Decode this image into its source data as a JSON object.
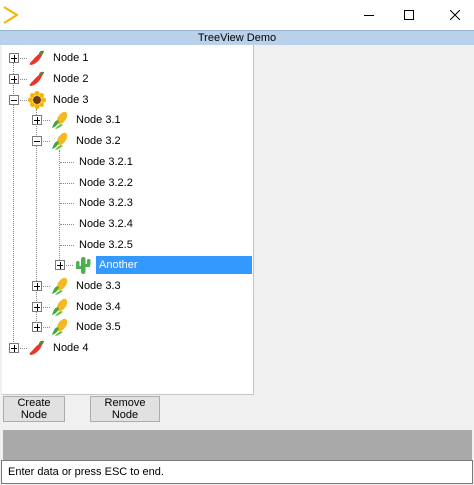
{
  "window": {
    "app_icon": "triangle-play-icon",
    "controls": [
      "minimize-icon",
      "maximize-icon",
      "close-icon"
    ]
  },
  "app": {
    "title": "TreeView Demo"
  },
  "tree": {
    "nodes": [
      {
        "label": "Node 1",
        "icon": "chili-icon",
        "level": 0,
        "expander": "plus"
      },
      {
        "label": "Node 2",
        "icon": "chili-icon",
        "level": 0,
        "expander": "plus"
      },
      {
        "label": "Node 3",
        "icon": "sunflower-icon",
        "level": 0,
        "expander": "minus"
      },
      {
        "label": "Node 3.1",
        "icon": "corn-icon",
        "level": 1,
        "expander": "plus"
      },
      {
        "label": "Node 3.2",
        "icon": "corn-icon",
        "level": 1,
        "expander": "minus"
      },
      {
        "label": "Node 3.2.1",
        "icon": "",
        "level": 2,
        "expander": "none"
      },
      {
        "label": "Node 3.2.2",
        "icon": "",
        "level": 2,
        "expander": "none"
      },
      {
        "label": "Node 3.2.3",
        "icon": "",
        "level": 2,
        "expander": "none"
      },
      {
        "label": "Node 3.2.4",
        "icon": "",
        "level": 2,
        "expander": "none"
      },
      {
        "label": "Node 3.2.5",
        "icon": "",
        "level": 2,
        "expander": "none"
      },
      {
        "label": "Another",
        "icon": "cactus-icon",
        "level": 2,
        "expander": "plus",
        "selected": true
      },
      {
        "label": "Node 3.3",
        "icon": "corn-icon",
        "level": 1,
        "expander": "plus"
      },
      {
        "label": "Node 3.4",
        "icon": "corn-icon",
        "level": 1,
        "expander": "plus"
      },
      {
        "label": "Node 3.5",
        "icon": "corn-icon",
        "level": 1,
        "expander": "plus"
      },
      {
        "label": "Node 4",
        "icon": "chili-icon",
        "level": 0,
        "expander": "plus"
      }
    ]
  },
  "buttons": {
    "create": "Create Node",
    "remove": "Remove Node"
  },
  "status": {
    "value": "Enter data or press ESC to end."
  },
  "colors": {
    "selection": "#3399ff",
    "title_bar": "#b9d1ea",
    "gray_bar": "#a9a9a9"
  }
}
